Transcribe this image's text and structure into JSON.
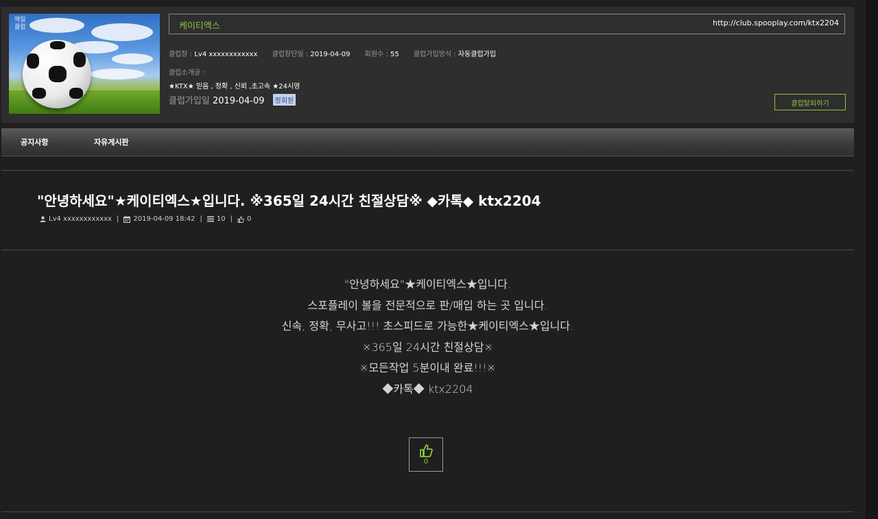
{
  "club": {
    "image_caption": "매일 클럽",
    "name": "케이티엑스",
    "url": "http://club.spooplay.com/ktx2204",
    "owner_label": "클럽장 :",
    "owner_value": "Lv4 xxxxxxxxxxxx",
    "founded_label": "클럽창단일 :",
    "founded_value": "2019-04-09",
    "members_label": "회원수 :",
    "members_value": "55",
    "join_method_label": "클럽가입방식 :",
    "join_method_value": "자동클럽가입",
    "intro_label": "클럽소개글 :",
    "intro_text": "★KTX★ 믿음 , 정확 , 신뢰 ,초고속 ★24시영",
    "join_date_label": "클럽가입일",
    "join_date_value": "2019-04-09",
    "member_badge": "정회원",
    "leave_button": "클럽탈퇴하기"
  },
  "nav": {
    "items": [
      {
        "label": "공지사항"
      },
      {
        "label": "자유게시판"
      }
    ]
  },
  "post": {
    "title": "\"안녕하세요\"★케이티엑스★입니다. ※365일 24시간 친절상담※ ◆카톡◆ ktx2204",
    "author": "Lv4 xxxxxxxxxxxx",
    "datetime": "2019-04-09 18:42",
    "views": "10",
    "likes": "0",
    "body_lines": [
      "\"안녕하세요\"★케이티엑스★입니다.",
      "스포플레이 볼을 전문적으로 판/매입 하는 곳 입니다.",
      "신속, 정확, 무사고!!! 초스피드로 가능한★케이티엑스★입니다.",
      "※365일 24시간 친절상담※",
      "※모든작업 5분이내 완료!!!※",
      "◆카톡◆ ktx2204"
    ],
    "like_button_count": "0"
  },
  "colors": {
    "background": "#1f1f1f",
    "panel": "#2e2e2e",
    "accent_green": "#8cc63f",
    "badge_bg": "#c3d1ec"
  }
}
